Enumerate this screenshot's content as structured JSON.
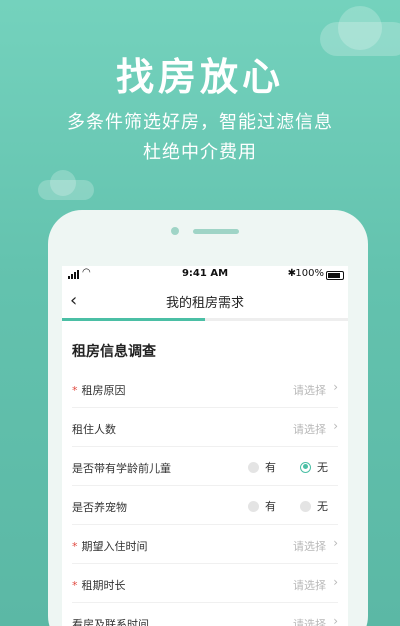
{
  "hero": {
    "title": "找房放心",
    "subtitle_line1": "多条件筛选好房，智能过滤信息",
    "subtitle_line2": "杜绝中介费用"
  },
  "status_bar": {
    "time": "9:41 AM",
    "battery": "100%"
  },
  "nav": {
    "back_icon": "‹",
    "title": "我的租房需求"
  },
  "progress": {
    "fraction": 0.5
  },
  "section": {
    "title": "租房信息调查"
  },
  "form": {
    "rows": [
      {
        "label": "租房原因",
        "required": "*",
        "value": "请选择"
      },
      {
        "label": "租住人数",
        "value": "请选择"
      },
      {
        "label": "是否带有学龄前儿童",
        "options": [
          "有",
          "无"
        ],
        "selected": "无"
      },
      {
        "label": "是否养宠物",
        "options": [
          "有",
          "无"
        ]
      },
      {
        "label": "期望入住时间",
        "required": "*",
        "value": "请选择"
      },
      {
        "label": "租期时长",
        "required": "*",
        "value": "请选择"
      },
      {
        "label": "看房及联系时间",
        "value": "请选择"
      }
    ]
  },
  "colors": {
    "accent": "#4bbfa5",
    "required": "#e0483e",
    "background_top": "#74d2bd"
  }
}
